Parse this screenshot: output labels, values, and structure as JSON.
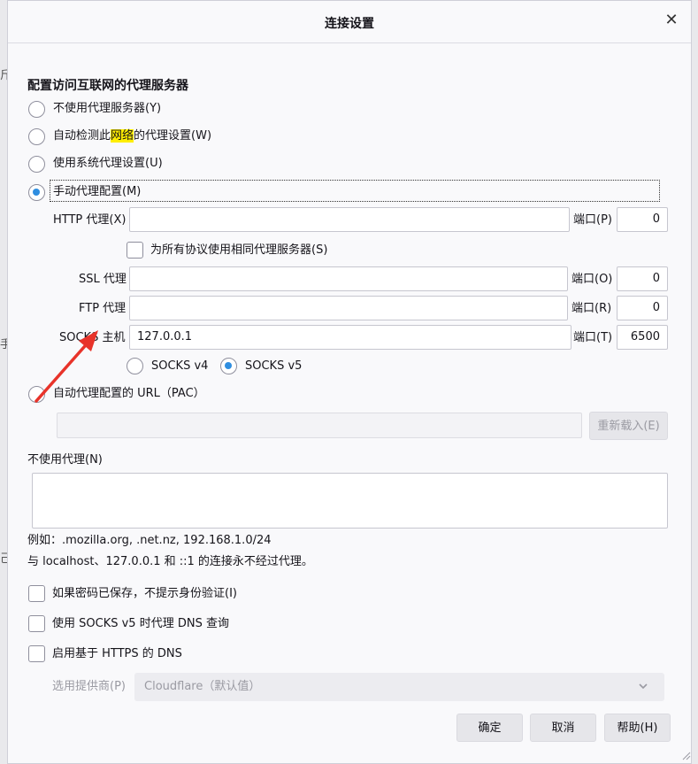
{
  "dialog": {
    "title": "连接设置",
    "close_glyph": "✕"
  },
  "proxy": {
    "section_title": "配置访问互联网的代理服务器",
    "options": {
      "none": "不使用代理服务器(Y)",
      "auto_detect_pre": "自动检测此",
      "auto_detect_hl": "网络",
      "auto_detect_post": "的代理设置(W)",
      "system": "使用系统代理设置(U)",
      "manual": "手动代理配置(M)",
      "pac": "自动代理配置的 URL（PAC）"
    },
    "selected": "manual"
  },
  "manual": {
    "http_label": "HTTP 代理(X)",
    "http_value": "",
    "http_port_label": "端口(P)",
    "http_port": "0",
    "same_proxy_label": "为所有协议使用相同代理服务器(S)",
    "same_proxy_checked": false,
    "ssl_label": "SSL 代理",
    "ssl_value": "",
    "ssl_port_label": "端口(O)",
    "ssl_port": "0",
    "ftp_label": "FTP 代理",
    "ftp_value": "",
    "ftp_port_label": "端口(R)",
    "ftp_port": "0",
    "socks_label": "SOCKS 主机",
    "socks_value": "127.0.0.1",
    "socks_port_label": "端口(T)",
    "socks_port": "6500",
    "socks_v4": "SOCKS v4",
    "socks_v5": "SOCKS v5",
    "socks_version": "v5"
  },
  "pac": {
    "url": "",
    "reload_label": "重新载入(E)"
  },
  "no_proxy": {
    "label": "不使用代理(N)",
    "value": "",
    "example": "例如：.mozilla.org, .net.nz, 192.168.1.0/24",
    "note": "与 localhost、127.0.0.1 和 ::1 的连接永不经过代理。"
  },
  "options": {
    "no_auth_prompt": "如果密码已保存，不提示身份验证(I)",
    "socks_dns": "使用 SOCKS v5 时代理 DNS 查询",
    "doh": "启用基于 HTTPS 的 DNS",
    "provider_label": "选用提供商(P)",
    "provider_value": "Cloudflare（默认值）"
  },
  "buttons": {
    "ok": "确定",
    "cancel": "取消",
    "help": "帮助(H)"
  },
  "colors": {
    "accent": "#2f8ee0",
    "highlight": "#ffee00",
    "annotation_arrow": "#e8332a"
  }
}
